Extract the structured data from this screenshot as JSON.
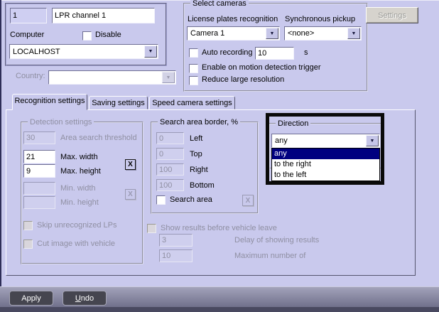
{
  "header": {
    "channel_id": "1",
    "channel_name": "LPR channel 1",
    "computer_label": "Computer",
    "disable_label": "Disable",
    "computer_value": "LOCALHOST",
    "country_label": "Country:",
    "country_value": ""
  },
  "select_cameras": {
    "title": "Select cameras",
    "lpr_label": "License plates recognition",
    "lpr_value": "Camera 1",
    "sync_label": "Synchronous pickup",
    "sync_value": "<none>",
    "auto_recording_label": "Auto recording",
    "auto_recording_value": "10",
    "auto_recording_unit": "s",
    "motion_trigger_label": "Enable on motion detection trigger",
    "reduce_resolution_label": "Reduce large resolution"
  },
  "settings_button_label": "Settings",
  "tabs": [
    {
      "label": "Recognition settings",
      "active": true
    },
    {
      "label": "Saving settings",
      "active": false
    },
    {
      "label": "Speed camera settings",
      "active": false
    }
  ],
  "detection": {
    "title": "Detection settings",
    "area_search_threshold": {
      "value": "30",
      "label": "Area search threshold"
    },
    "max_width": {
      "value": "21",
      "label": "Max. width"
    },
    "max_height": {
      "value": "9",
      "label": "Max. height"
    },
    "min_width": {
      "value": "",
      "label": "Min. width"
    },
    "min_height": {
      "value": "",
      "label": "Min. height"
    },
    "clear_max_label": "X",
    "clear_min_label": "X",
    "skip_unrecognized_label": "Skip unrecognized LPs",
    "cut_image_label": "Cut image with vehicle"
  },
  "search_area": {
    "title": "Search area border, %",
    "left": {
      "value": "0",
      "label": "Left"
    },
    "top": {
      "value": "0",
      "label": "Top"
    },
    "right": {
      "value": "100",
      "label": "Right"
    },
    "bottom": {
      "value": "100",
      "label": "Bottom"
    },
    "checkbox_label": "Search area",
    "clear_label": "X"
  },
  "direction": {
    "title": "Direction",
    "value": "any",
    "options": [
      "any",
      "to the right",
      "to the left"
    ],
    "selected_index": 0
  },
  "results": {
    "show_label": "Show results before vehicle leave",
    "delay": {
      "value": "3",
      "label": "Delay of showing results"
    },
    "maximum": {
      "value": "10",
      "label": "Maximum number of"
    }
  },
  "footer": {
    "apply_label": "Apply",
    "undo_label": "Undo"
  },
  "colors": {
    "dialog_bg": "#c9c9ed",
    "field_bg": "#ffffff",
    "disabled_text": "#8f8fa2",
    "selection_bg": "#000080",
    "highlight_border": "#0a0a0a",
    "footer_bar_top": "#a2a2ba",
    "footer_bar_bottom": "#6f6f8a",
    "footer_button_bg": "#45454f"
  }
}
